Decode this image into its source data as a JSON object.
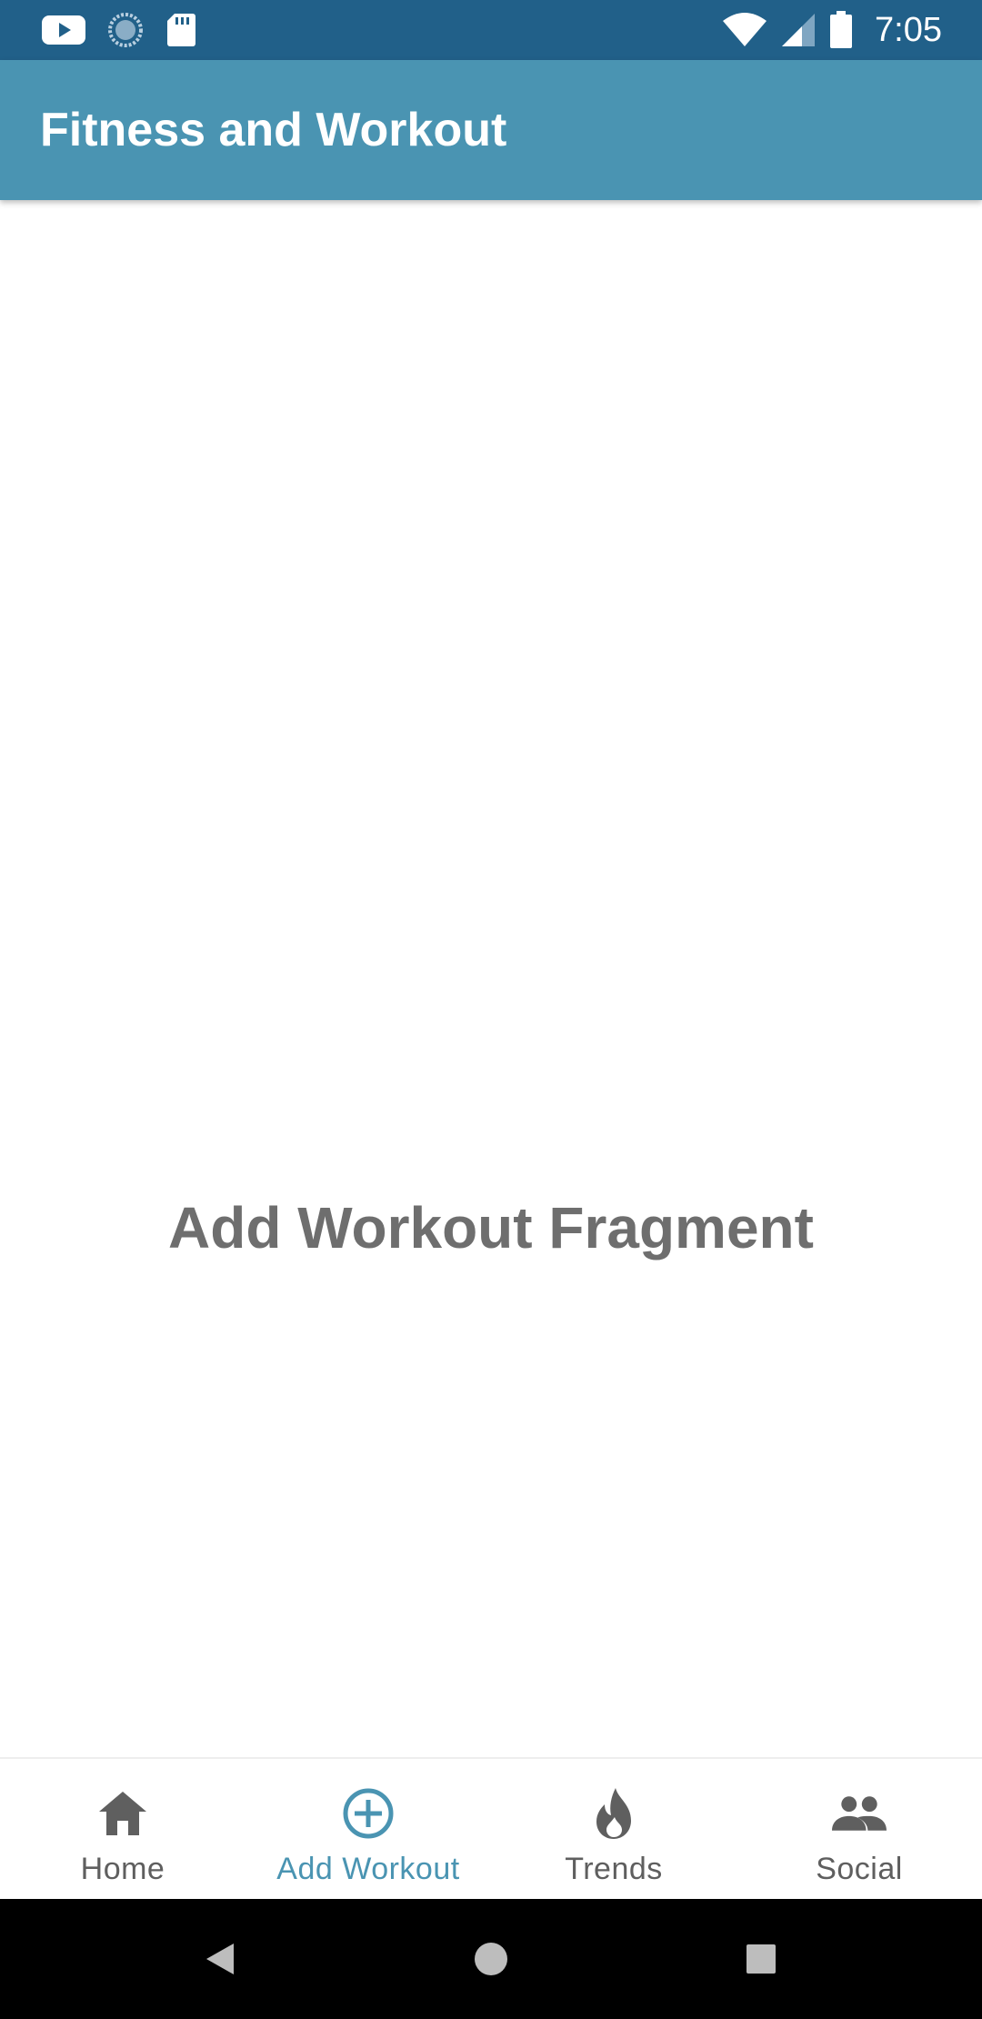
{
  "status_bar": {
    "time": "7:05",
    "left_icons": [
      "youtube-icon",
      "loading-icon",
      "sd-card-icon"
    ],
    "right_icons": [
      "wifi-icon",
      "signal-icon",
      "battery-icon"
    ]
  },
  "app_bar": {
    "title": "Fitness and Workout"
  },
  "content": {
    "fragment_text": "Add Workout Fragment"
  },
  "bottom_nav": {
    "items": [
      {
        "label": "Home",
        "icon": "home-icon",
        "active": false
      },
      {
        "label": "Add Workout",
        "icon": "add-circle-icon",
        "active": true
      },
      {
        "label": "Trends",
        "icon": "flame-icon",
        "active": false
      },
      {
        "label": "Social",
        "icon": "people-icon",
        "active": false
      }
    ]
  },
  "system_nav": {
    "buttons": [
      "back-icon",
      "home-circle-icon",
      "recents-icon"
    ]
  },
  "colors": {
    "status_bar": "#216089",
    "app_bar": "#4a94b2",
    "active": "#4a94b2",
    "inactive": "#5f5f5f",
    "fragment_text": "#6e6e6e"
  }
}
